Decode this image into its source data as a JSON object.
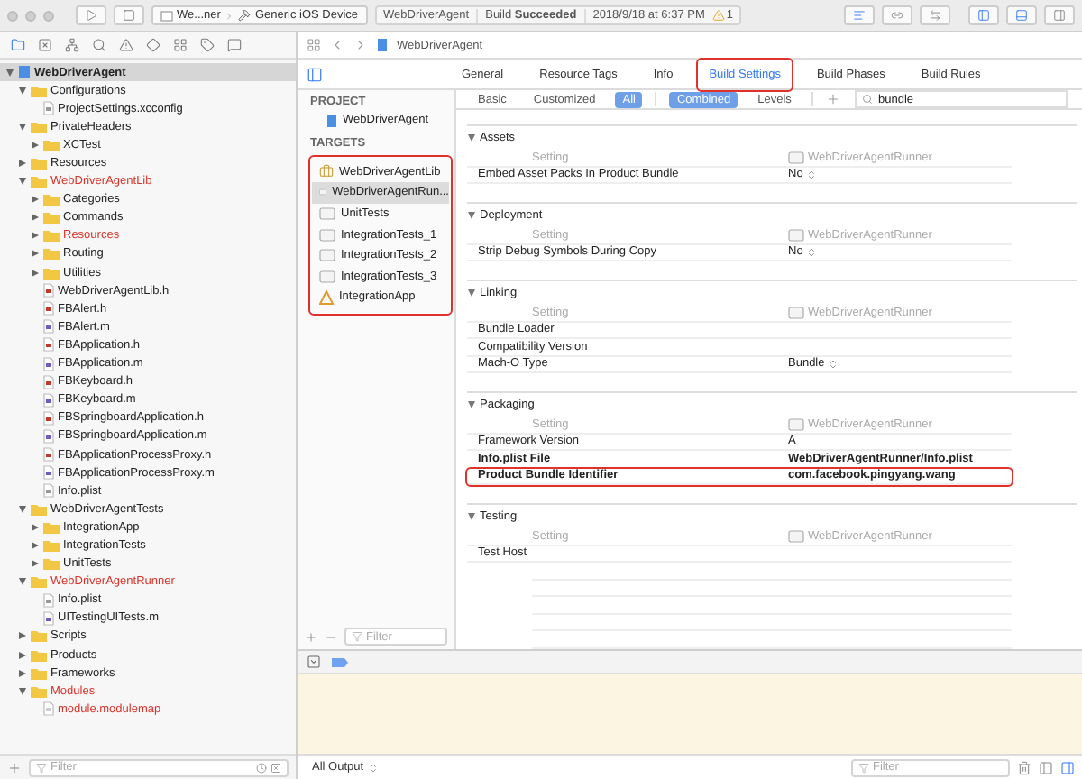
{
  "toolbar": {
    "scheme": "We...ner",
    "device": "Generic iOS Device",
    "status": {
      "project": "WebDriverAgent",
      "result": "Build **Succeeded**",
      "time": "2018/9/18 at 6:37 PM"
    },
    "warnings": "1"
  },
  "navigator": {
    "tree": [
      {
        "name": "WebDriverAgent",
        "kind": "project",
        "expanded": true,
        "selected": true,
        "children": [
          {
            "name": "Configurations",
            "kind": "folder",
            "expanded": true,
            "selected": false,
            "children": [
              {
                "name": "ProjectSettings.xcconfig",
                "kind": "config",
                "selected": false
              }
            ]
          },
          {
            "name": "PrivateHeaders",
            "kind": "folder",
            "expanded": true,
            "selected": false,
            "children": [
              {
                "name": "XCTest",
                "kind": "folder",
                "expanded": false,
                "selected": false
              }
            ]
          },
          {
            "name": "Resources",
            "kind": "folder",
            "expanded": false,
            "selected": false
          },
          {
            "name": "WebDriverAgentLib",
            "kind": "folder",
            "expanded": true,
            "selected": false,
            "color": "#d9342b",
            "children": [
              {
                "name": "Categories",
                "kind": "folder",
                "expanded": false,
                "selected": false
              },
              {
                "name": "Commands",
                "kind": "folder",
                "expanded": false,
                "selected": false
              },
              {
                "name": "Resources",
                "kind": "folder",
                "expanded": false,
                "selected": false,
                "color": "#d9342b"
              },
              {
                "name": "Routing",
                "kind": "folder",
                "expanded": false,
                "selected": false
              },
              {
                "name": "Utilities",
                "kind": "folder",
                "expanded": false,
                "selected": false
              },
              {
                "name": "WebDriverAgentLib.h",
                "kind": "header",
                "selected": false
              },
              {
                "name": "FBAlert.h",
                "kind": "header",
                "selected": false
              },
              {
                "name": "FBAlert.m",
                "kind": "source",
                "selected": false
              },
              {
                "name": "FBApplication.h",
                "kind": "header",
                "selected": false
              },
              {
                "name": "FBApplication.m",
                "kind": "source",
                "selected": false
              },
              {
                "name": "FBKeyboard.h",
                "kind": "header",
                "selected": false
              },
              {
                "name": "FBKeyboard.m",
                "kind": "source",
                "selected": false
              },
              {
                "name": "FBSpringboardApplication.h",
                "kind": "header",
                "selected": false
              },
              {
                "name": "FBSpringboardApplication.m",
                "kind": "source",
                "selected": false
              },
              {
                "name": "FBApplicationProcessProxy.h",
                "kind": "header",
                "selected": false
              },
              {
                "name": "FBApplicationProcessProxy.m",
                "kind": "source",
                "selected": false
              },
              {
                "name": "Info.plist",
                "kind": "plist",
                "selected": false
              }
            ]
          },
          {
            "name": "WebDriverAgentTests",
            "kind": "folder",
            "expanded": true,
            "selected": false,
            "children": [
              {
                "name": "IntegrationApp",
                "kind": "folder",
                "expanded": false,
                "selected": false
              },
              {
                "name": "IntegrationTests",
                "kind": "folder",
                "expanded": false,
                "selected": false
              },
              {
                "name": "UnitTests",
                "kind": "folder",
                "expanded": false,
                "selected": false
              }
            ]
          },
          {
            "name": "WebDriverAgentRunner",
            "kind": "folder",
            "expanded": true,
            "selected": false,
            "color": "#d9342b",
            "children": [
              {
                "name": "Info.plist",
                "kind": "plist",
                "selected": false
              },
              {
                "name": "UITestingUITests.m",
                "kind": "source",
                "selected": false
              }
            ]
          },
          {
            "name": "Scripts",
            "kind": "folder",
            "expanded": false,
            "selected": false
          },
          {
            "name": "Products",
            "kind": "folder",
            "expanded": false,
            "selected": false
          },
          {
            "name": "Frameworks",
            "kind": "folder",
            "expanded": false,
            "selected": false
          },
          {
            "name": "Modules",
            "kind": "folder",
            "expanded": true,
            "selected": false,
            "color": "#d9342b",
            "children": [
              {
                "name": "module.modulemap",
                "kind": "file",
                "selected": false,
                "color": "#d9342b"
              }
            ]
          }
        ]
      }
    ],
    "filter": {
      "placeholder": "Filter"
    }
  },
  "jump_bar": {
    "path": "WebDriverAgent"
  },
  "editor_tabs": [
    {
      "label": "General",
      "selected": false,
      "highlighted": false
    },
    {
      "label": "Resource Tags",
      "selected": false,
      "highlighted": false
    },
    {
      "label": "Info",
      "selected": false,
      "highlighted": false
    },
    {
      "label": "Build Settings",
      "selected": true,
      "highlighted": true
    },
    {
      "label": "Build Phases",
      "selected": false,
      "highlighted": false
    },
    {
      "label": "Build Rules",
      "selected": false,
      "highlighted": false
    }
  ],
  "targets_panel": {
    "project_heading": "PROJECT",
    "project": "WebDriverAgent",
    "targets_heading": "TARGETS",
    "highlighted": true,
    "targets": [
      {
        "name": "WebDriverAgentLib",
        "kind": "framework",
        "selected": false
      },
      {
        "name": "WebDriverAgentRun...",
        "kind": "bundle",
        "selected": true
      },
      {
        "name": "UnitTests",
        "kind": "bundle",
        "selected": false
      },
      {
        "name": "IntegrationTests_1",
        "kind": "bundle",
        "selected": false
      },
      {
        "name": "IntegrationTests_2",
        "kind": "bundle",
        "selected": false
      },
      {
        "name": "IntegrationTests_3",
        "kind": "bundle",
        "selected": false
      },
      {
        "name": "IntegrationApp",
        "kind": "app",
        "selected": false
      }
    ],
    "filter": {
      "placeholder": "Filter"
    }
  },
  "filter_bar": {
    "scopes": [
      {
        "label": "Basic",
        "selected": false
      },
      {
        "label": "Customized",
        "selected": false
      },
      {
        "label": "All",
        "selected": true
      }
    ],
    "modes": [
      {
        "label": "Combined",
        "selected": true
      },
      {
        "label": "Levels",
        "selected": false
      }
    ],
    "search": {
      "value": "bundle"
    }
  },
  "sections": [
    {
      "title": "Assets",
      "expanded": true,
      "setting_column": "Setting",
      "target_column": "WebDriverAgentRunner",
      "rows": [
        {
          "name": "Embed Asset Packs In Product Bundle",
          "value": "No",
          "kind": "popup",
          "bold": false,
          "highlighted": false
        }
      ]
    },
    {
      "title": "Deployment",
      "expanded": true,
      "setting_column": "Setting",
      "target_column": "WebDriverAgentRunner",
      "rows": [
        {
          "name": "Strip Debug Symbols During Copy",
          "value": "No",
          "kind": "popup",
          "bold": false,
          "highlighted": false
        }
      ]
    },
    {
      "title": "Linking",
      "expanded": true,
      "setting_column": "Setting",
      "target_column": "WebDriverAgentRunner",
      "rows": [
        {
          "name": "Bundle Loader",
          "bold": false,
          "highlighted": false
        },
        {
          "name": "Compatibility Version",
          "bold": false,
          "highlighted": false
        },
        {
          "name": "Mach-O Type",
          "value": "Bundle",
          "kind": "popup",
          "bold": false,
          "highlighted": false
        }
      ]
    },
    {
      "title": "Packaging",
      "expanded": true,
      "setting_column": "Setting",
      "target_column": "WebDriverAgentRunner",
      "rows": [
        {
          "name": "Framework Version",
          "value": "A",
          "kind": "text",
          "bold": false,
          "highlighted": false
        },
        {
          "name": "Info.plist File",
          "value": "WebDriverAgentRunner/Info.plist",
          "kind": "text",
          "bold": true,
          "highlighted": false
        },
        {
          "name": "Product Bundle Identifier",
          "value": "com.facebook.pingyang.wang",
          "kind": "text",
          "bold": true,
          "highlighted": true
        }
      ]
    },
    {
      "title": "Testing",
      "expanded": true,
      "setting_column": "Setting",
      "target_column": "WebDriverAgentRunner",
      "rows": [
        {
          "name": "Test Host",
          "bold": false,
          "highlighted": false
        }
      ]
    }
  ],
  "debug": {
    "output_selector": "All Output",
    "filter": {
      "placeholder": "Filter"
    }
  }
}
